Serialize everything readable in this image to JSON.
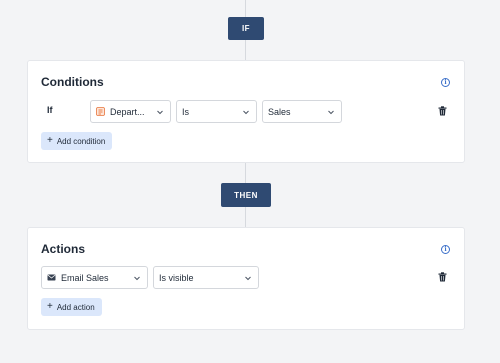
{
  "if_badge": "IF",
  "then_badge": "THEN",
  "conditions": {
    "title": "Conditions",
    "info_glyph": "i",
    "row": {
      "prefix": "If",
      "field": "Depart...",
      "field_icon": "form-field-icon",
      "operator": "Is",
      "value": "Sales"
    },
    "add_label": "Add condition"
  },
  "actions": {
    "title": "Actions",
    "info_glyph": "i",
    "row": {
      "target": "Email Sales",
      "target_icon": "envelope-icon",
      "action": "Is visible"
    },
    "add_label": "Add action"
  },
  "colors": {
    "badge": "#2f4a72",
    "accent": "#3b6fc9",
    "add_button_bg": "#dbe7fb",
    "field_icon": "#e8743b"
  }
}
